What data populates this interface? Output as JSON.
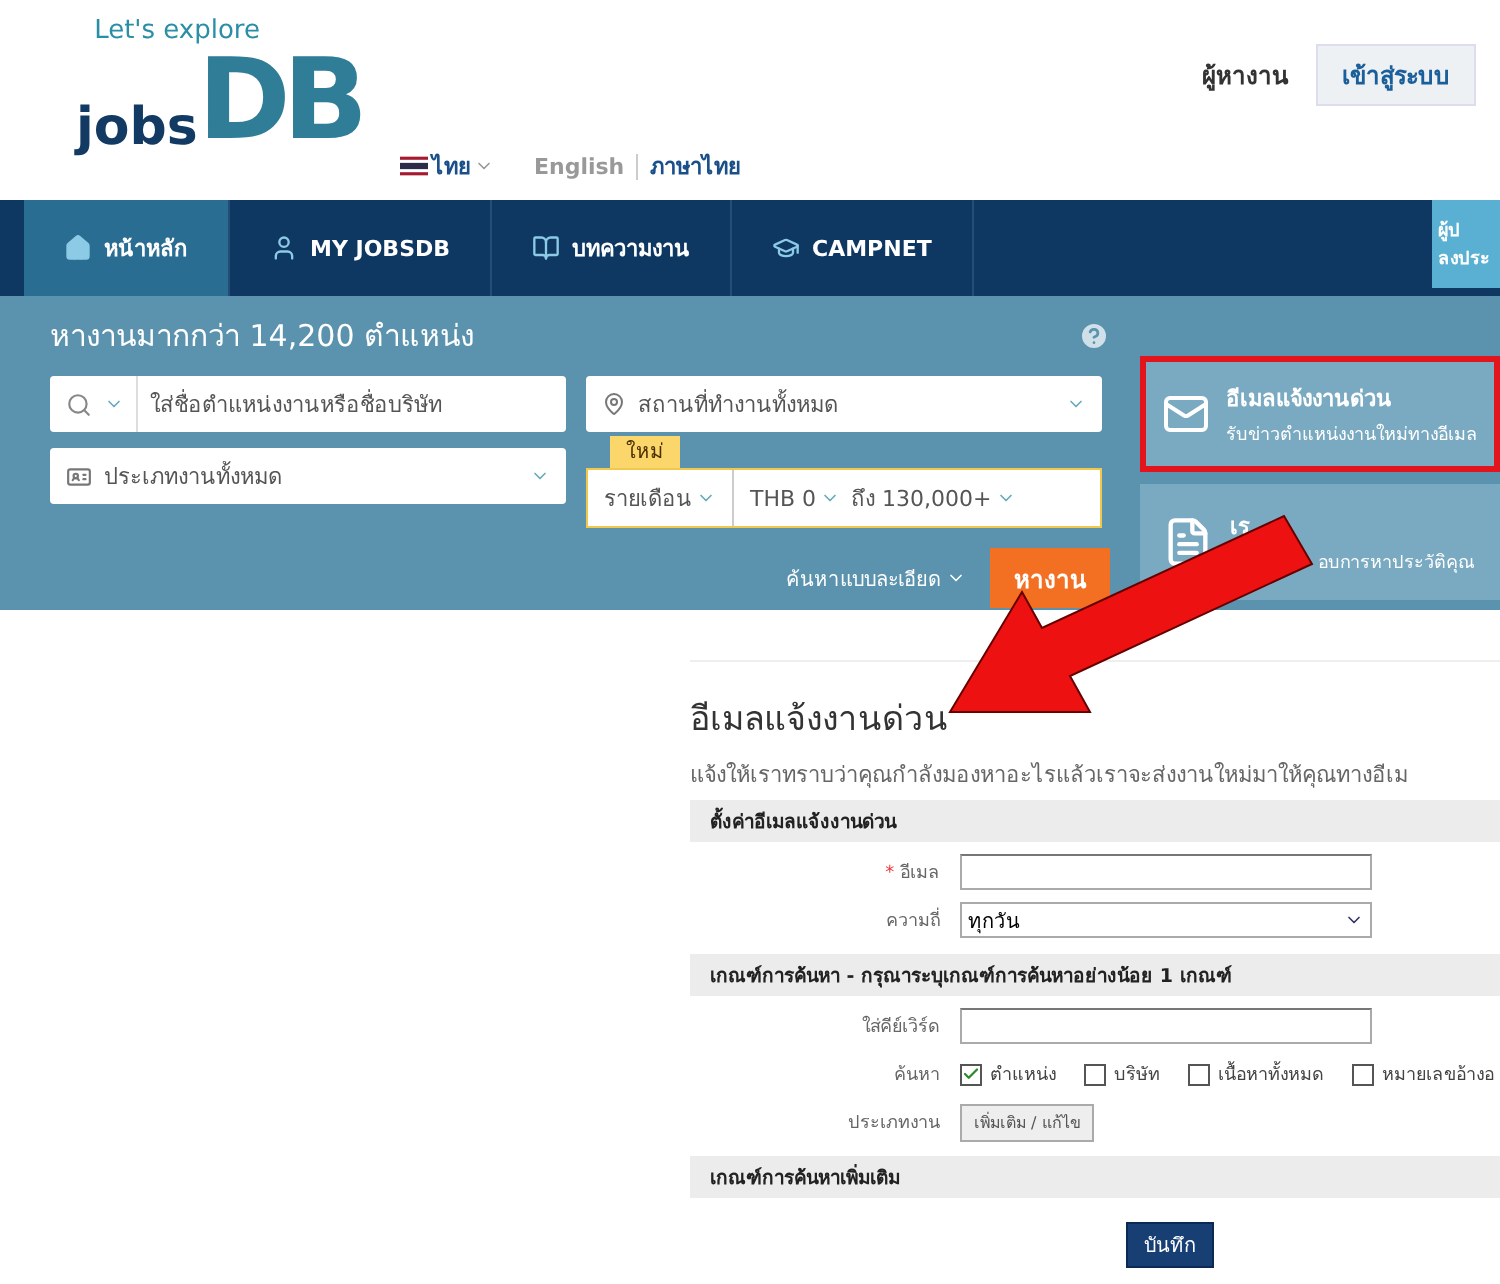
{
  "header": {
    "logo": {
      "tagline": "Let's explore",
      "word": "jobs",
      "mark": "DB"
    },
    "language": {
      "current": "ไทย",
      "options": [
        {
          "label": "English",
          "selected": false
        },
        {
          "label": "ภาษาไทย",
          "selected": true
        }
      ]
    },
    "employer_link": "ผู้หางาน",
    "login_button": "เข้าสู่ระบบ"
  },
  "nav": {
    "items": [
      {
        "label": "หน้าหลัก",
        "kind": "home",
        "selected": true
      },
      {
        "label": "MY JOBSDB",
        "kind": "user",
        "selected": false
      },
      {
        "label": "บทความงาน",
        "kind": "book",
        "selected": false
      },
      {
        "label": "CAMPNET",
        "kind": "cap",
        "selected": false
      }
    ],
    "side_tab": [
      "ผู้ป",
      "ลงประ"
    ]
  },
  "search": {
    "heading": "หางานมากกว่า 14,200 ตำแหน่ง",
    "keyword_placeholder": "ใส่ชื่อตำแหน่งงานหรือชื่อบริษัท",
    "location": "สถานที่ทำงานทั้งหมด",
    "job_type": "ประเภทงานทั้งหมด",
    "salary": {
      "badge": "ใหม่",
      "period": "รายเดือน",
      "from": "THB 0",
      "to_word": "ถึง",
      "to": "130,000+"
    },
    "advanced": "ค้นหาแบบละเอียด",
    "submit": "หางาน"
  },
  "side_panel": [
    {
      "title": "อีเมลแจ้งงานด่วน",
      "subtitle": "รับข่าวตำแหน่งงานใหม่ทางอีเมล",
      "kind": "mail",
      "highlighted": true
    },
    {
      "title": "เร",
      "subtitle": "อบการหาประวัติคุณ",
      "kind": "resume",
      "highlighted": false
    }
  ],
  "alert_form": {
    "title": "อีเมลแจ้งงานด่วน",
    "description": "แจ้งให้เราทราบว่าคุณกำลังมองหาอะไรแล้วเราจะส่งงานใหม่มาให้คุณทางอีเม",
    "sections": [
      {
        "heading": "ตั้งค่าอีเมลแจ้งงานด่วน",
        "rows": [
          {
            "kind": "text",
            "label": "อีเมล",
            "mark": "*"
          },
          {
            "kind": "select",
            "label": "ความถี่",
            "value": "ทุกวัน"
          }
        ]
      },
      {
        "heading": "**เกณฑ์การค้นหา** - กรุณาระบุเกณฑ์การค้นหาอย่างน้อย 1 เกณฑ์",
        "rows": [
          {
            "kind": "text",
            "label": "ใส่คีย์เวิร์ด"
          },
          {
            "kind": "checks",
            "label": "ค้นหา",
            "options": [
              {
                "label": "ตำแหน่ง",
                "checked": true
              },
              {
                "label": "บริษัท",
                "checked": false
              },
              {
                "label": "เนื้อหาทั้งหมด",
                "checked": false
              },
              {
                "label": "หมายเลขอ้างอ",
                "checked": false
              }
            ]
          },
          {
            "kind": "button",
            "label": "ประเภทงาน",
            "value": "เพิ่มเติม / แก้ไข"
          }
        ]
      },
      {
        "heading": "เกณฑ์การค้นหาเพิ่มเติม"
      }
    ],
    "save_button": "บันทึก"
  }
}
